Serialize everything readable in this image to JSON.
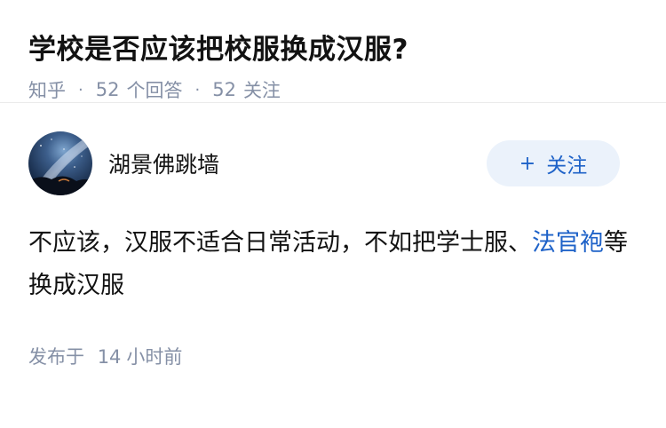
{
  "question": {
    "title": "学校是否应该把校服换成汉服?",
    "source": "知乎",
    "separator": "·",
    "answer_count": "52",
    "answer_label": "个回答",
    "follower_count": "52",
    "follower_label": "关注"
  },
  "answer": {
    "author_name": "湖景佛跳墙",
    "follow_plus": "+",
    "follow_label": "关注",
    "content_before_link": "不应该，汉服不适合日常活动，不如把学士服、",
    "content_link": "法官袍",
    "content_after_link": "等换成汉服",
    "time_prefix": "发布于",
    "time_value": "14",
    "time_suffix": "小时前"
  },
  "colors": {
    "link": "#1e62c8",
    "meta": "#8590a6",
    "follow_bg": "#ebf2fb"
  },
  "icons": {
    "avatar": "night-sky-avatar",
    "follow": "plus-icon"
  }
}
